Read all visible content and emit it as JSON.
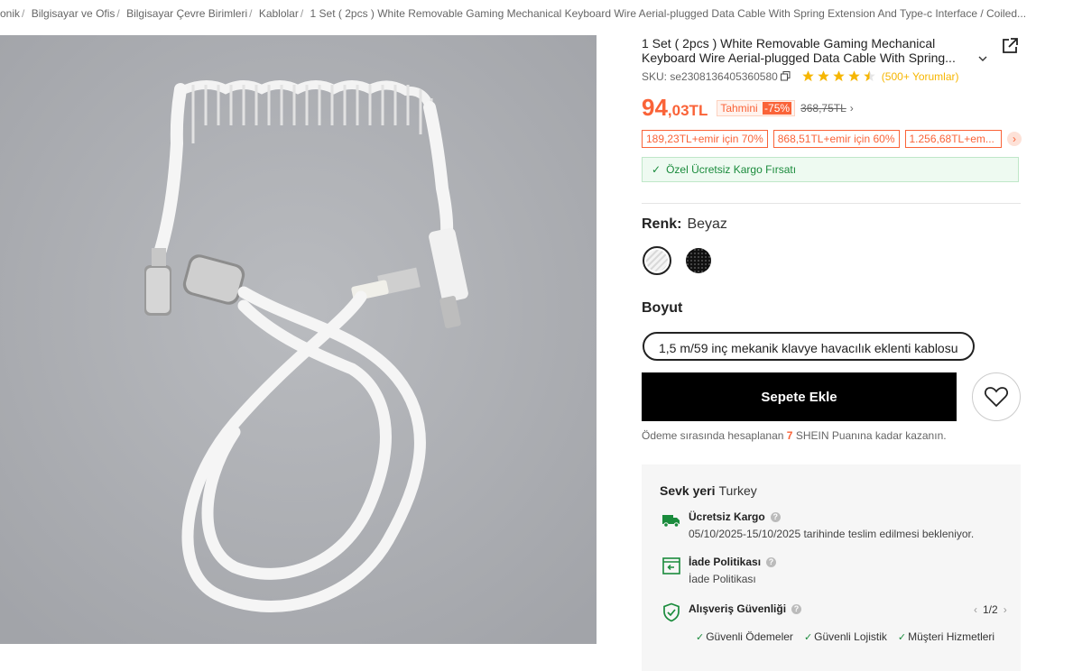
{
  "breadcrumb": {
    "items": [
      "onik",
      "Bilgisayar ve Ofis",
      "Bilgisayar Çevre Birimleri",
      "Kablolar",
      "1 Set ( 2pcs ) White Removable Gaming Mechanical Keyboard Wire Aerial-plugged Data Cable With Spring Extension And Type-c Interface / Coiled..."
    ]
  },
  "product": {
    "title": "1 Set ( 2pcs ) White Removable Gaming Mechanical Keyboard Wire Aerial-plugged Data Cable With Spring...",
    "sku": "SKU: se2308136405360580",
    "rating": 4.5,
    "reviews": "(500+ Yorumlar)"
  },
  "price": {
    "main": "94",
    "decimal": ",03TL",
    "estimated_label": "Tahmini",
    "discount": "-75%",
    "original": "368,75TL",
    "arrow": "›"
  },
  "coupons": [
    "189,23TL+emir için 70%",
    "868,51TL+emir için 60%",
    "1.256,68TL+em..."
  ],
  "coupon_next": "›",
  "shipping_banner": "Özel Ücretsiz Kargo Fırsatı",
  "color": {
    "label": "Renk:",
    "value": "Beyaz"
  },
  "size": {
    "label": "Boyut",
    "option": "1,5 m/59 inç mekanik klavye havacılık eklenti kablosu"
  },
  "actions": {
    "add_to_cart": "Sepete Ekle"
  },
  "points": {
    "prefix": "Ödeme sırasında hesaplanan",
    "value": "7",
    "suffix": "SHEIN Puanına kadar kazanın."
  },
  "shipping": {
    "from_label": "Sevk yeri",
    "from_value": "Turkey",
    "free_title": "Ücretsiz Kargo",
    "free_detail": "05/10/2025-15/10/2025 tarihinde teslim edilmesi bekleniyor.",
    "return_title": "İade Politikası",
    "return_detail": "İade Politikası",
    "security_title": "Alışveriş Güvenliği",
    "pager": "1/2",
    "security_tags": [
      "Güvenli Ödemeler",
      "Güvenli Lojistik",
      "Müşteri Hizmetleri"
    ]
  },
  "colors": {
    "accent": "#fa6338",
    "green": "#1a8b3c",
    "star": "#f6b602"
  },
  "icons": [
    "share-icon",
    "copy-icon",
    "star-icon",
    "check-icon",
    "heart-icon",
    "truck-icon",
    "return-icon",
    "shield-icon",
    "chevron-down-icon"
  ]
}
